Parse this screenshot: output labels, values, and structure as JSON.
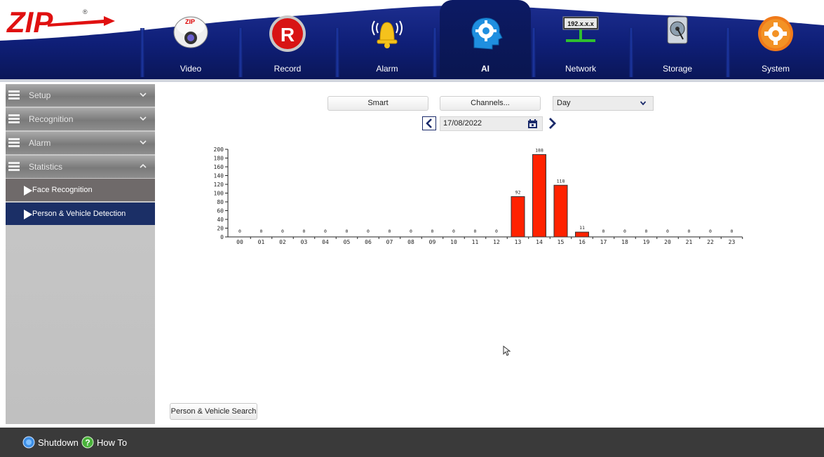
{
  "nav": {
    "items": [
      {
        "label": "Video"
      },
      {
        "label": "Record"
      },
      {
        "label": "Alarm"
      },
      {
        "label": "AI"
      },
      {
        "label": "Network"
      },
      {
        "label": "Storage"
      },
      {
        "label": "System"
      }
    ],
    "active": "AI",
    "network_badge": "192.x.x.x"
  },
  "logo": {
    "text": "ZIP",
    "registered": "®"
  },
  "sidebar": {
    "sections": [
      {
        "label": "Setup",
        "expanded": false
      },
      {
        "label": "Recognition",
        "expanded": false
      },
      {
        "label": "Alarm",
        "expanded": false
      },
      {
        "label": "Statistics",
        "expanded": true
      }
    ],
    "sub_items": [
      {
        "label": "Face Recognition",
        "selected": false
      },
      {
        "label": "Person & Vehicle Detection",
        "selected": true
      }
    ]
  },
  "toolbar": {
    "smart_label": "Smart",
    "channels_label": "Channels...",
    "period_value": "Day",
    "date_value": "17/08/2022"
  },
  "chart_data": {
    "type": "bar",
    "categories": [
      "00",
      "01",
      "02",
      "03",
      "04",
      "05",
      "06",
      "07",
      "08",
      "09",
      "10",
      "11",
      "12",
      "13",
      "14",
      "15",
      "16",
      "17",
      "18",
      "19",
      "20",
      "21",
      "22",
      "23"
    ],
    "values": [
      0,
      0,
      0,
      0,
      0,
      0,
      0,
      0,
      0,
      0,
      0,
      0,
      0,
      92,
      188,
      118,
      11,
      0,
      0,
      0,
      0,
      0,
      0,
      0
    ],
    "yticks": [
      0,
      20,
      40,
      60,
      80,
      100,
      120,
      140,
      160,
      180,
      200
    ],
    "ylim": [
      0,
      200
    ],
    "bar_color": "#ff2200",
    "grid": false
  },
  "search_button_label": "Person & Vehicle Search",
  "footer": {
    "shutdown_label": "Shutdown",
    "howto_label": "How To"
  }
}
